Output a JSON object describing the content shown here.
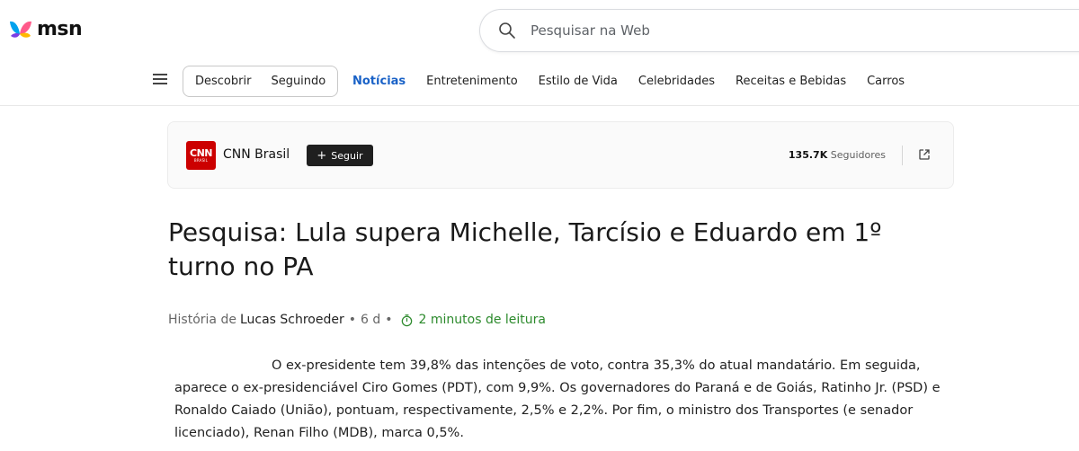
{
  "header": {
    "logo_text": "msn",
    "search_placeholder": "Pesquisar na Web"
  },
  "nav": {
    "pill_items": [
      "Descobrir",
      "Seguindo"
    ],
    "links": [
      "Notícias",
      "Entretenimento",
      "Estilo de Vida",
      "Celebridades",
      "Receitas e Bebidas",
      "Carros"
    ],
    "active_link": "Notícias"
  },
  "source": {
    "logo_text": "CNN",
    "logo_subtext": "BRASIL",
    "name": "CNN Brasil",
    "follow_label": "Seguir",
    "followers_count": "135.7K",
    "followers_label": "Seguidores"
  },
  "article": {
    "title": "Pesquisa: Lula supera Michelle, Tarcísio e Eduardo em 1º turno no PA",
    "byline_prefix": "História de",
    "author": "Lucas Schroeder",
    "age": "6 d",
    "read_time": "2 minutos de leitura",
    "body": "O ex-presidente tem 39,8% das intenções de voto, contra 35,3% do atual mandatário. Em seguida, aparece o ex-presidenciável Ciro Gomes (PDT), com 9,9%. Os governadores do Paraná e de Goiás, Ratinho Jr. (PSD) e Ronaldo Caiado (União), pontuam, respectivamente, 2,5% e 2,2%. Por fim, o ministro dos Transportes (e senador licenciado), Renan Filho (MDB), marca 0,5%."
  },
  "colors": {
    "accent_blue": "#1a62c7",
    "cnn_red": "#cc0000",
    "read_time_green": "#2c8a2c"
  }
}
